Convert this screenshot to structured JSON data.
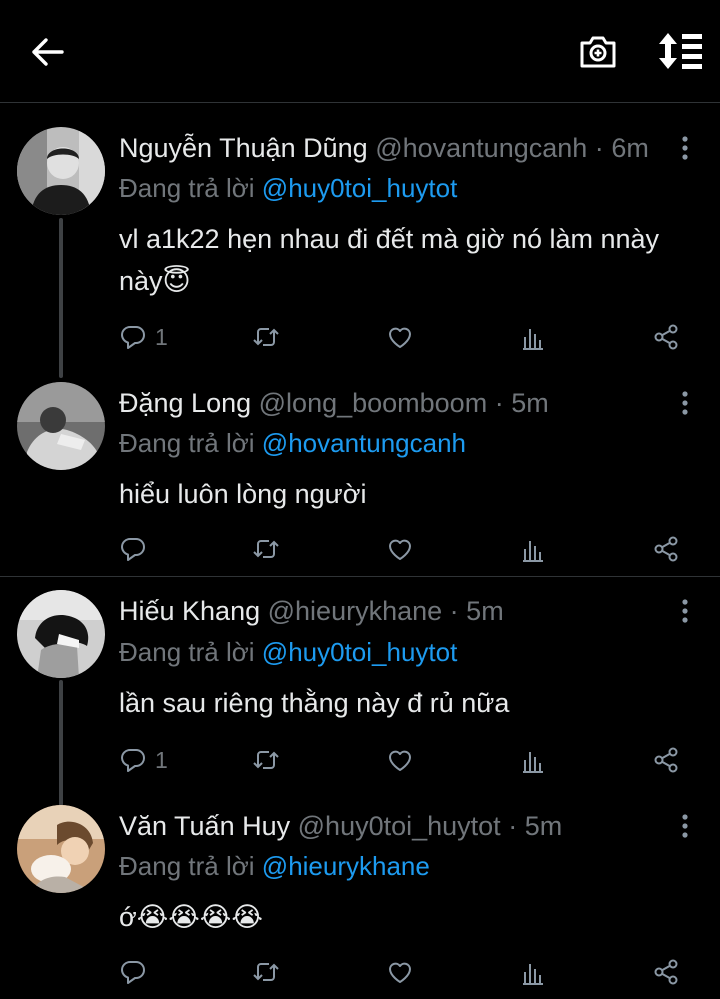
{
  "header": {
    "back_icon": "arrow-left-icon",
    "camera_icon": "camera-add-icon",
    "sort_icon": "sort-icon"
  },
  "colors": {
    "background": "#000000",
    "text": "#e7e9ea",
    "muted": "#71767b",
    "accent": "#1d9bf0",
    "divider": "#2f3336"
  },
  "replying_label": "Đang trả lời",
  "tweets": [
    {
      "name": "Nguyễn Thuận Dũng",
      "handle": "@hovantungcanh",
      "dot": "·",
      "time": "6m",
      "replying_to": "@huy0toi_huytot",
      "text": "vl a1k22 hẹn nhau đi đết mà giờ nó làm nnày này😇",
      "reply_count": "1"
    },
    {
      "name": "Đặng Long",
      "handle": "@long_boomboom",
      "dot": "·",
      "time": "5m",
      "replying_to": "@hovantungcanh",
      "text": "hiểu luôn lòng người",
      "reply_count": ""
    },
    {
      "name": "Hiếu Khang",
      "handle": "@hieurykhane",
      "dot": "·",
      "time": "5m",
      "replying_to": "@huy0toi_huytot",
      "text": "lần sau riêng thằng này đ rủ nữa",
      "reply_count": "1"
    },
    {
      "name": "Văn Tuấn Huy",
      "handle": "@huy0toi_huytot",
      "dot": "·",
      "time": "5m",
      "replying_to": "@hieurykhane",
      "text": "ớ😭😭😭😭",
      "reply_count": ""
    }
  ],
  "action_icons": [
    "reply-icon",
    "retweet-icon",
    "like-icon",
    "analytics-icon",
    "share-icon"
  ]
}
